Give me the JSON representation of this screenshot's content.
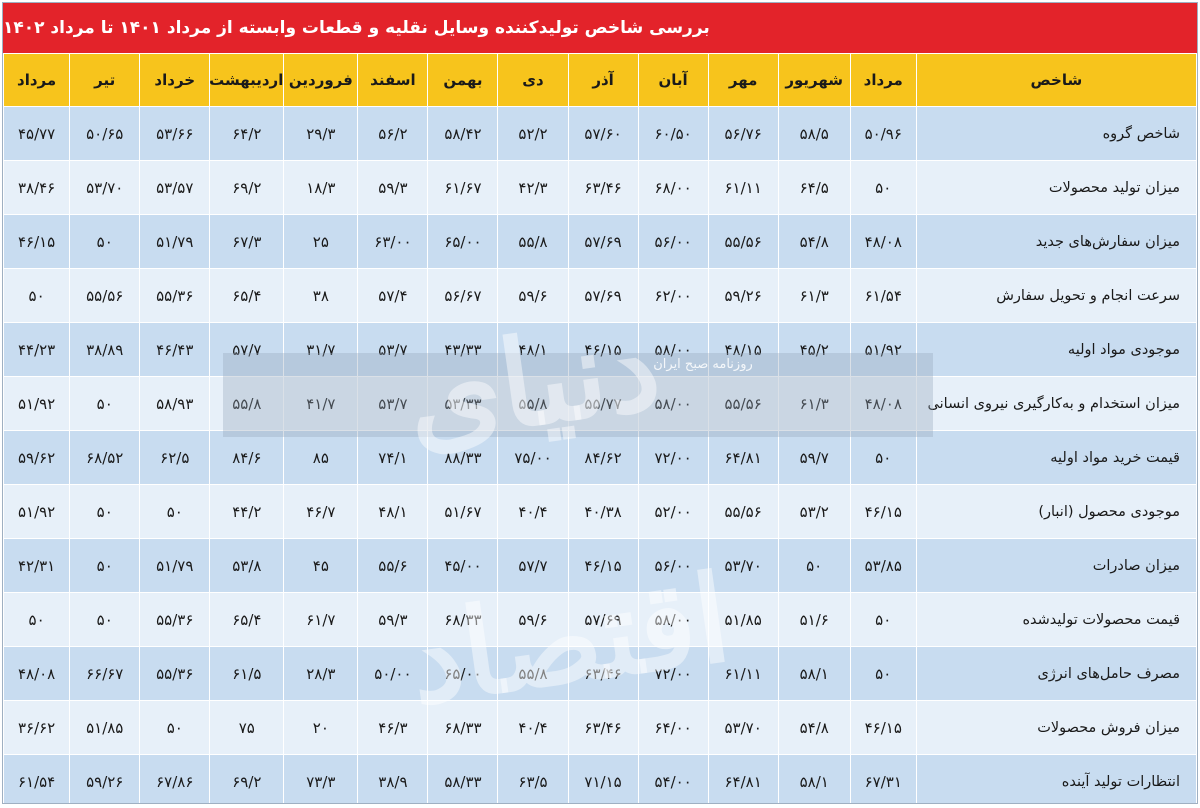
{
  "title": "بررسی شاخص تولیدکننده وسایل نقلیه و قطعات وابسته از مرداد ۱۴۰۱ تا مرداد ۱۴۰۲",
  "watermark": {
    "main": "دنیای اقتصاد",
    "sub": "روزنامه صبح ایران"
  },
  "chart_data": {
    "type": "table",
    "title": "بررسی شاخص تولیدکننده وسایل نقلیه و قطعات وابسته از مرداد ۱۴۰۱ تا مرداد ۱۴۰۲",
    "columns": [
      "شاخص",
      "مرداد",
      "شهریور",
      "مهر",
      "آبان",
      "آذر",
      "دی",
      "بهمن",
      "اسفند",
      "فروردین",
      "اردیبهشت",
      "خرداد",
      "تیر",
      "مرداد"
    ],
    "rows": [
      {
        "name": "شاخص گروه",
        "values": [
          "۵۰/۹۶",
          "۵۸/۵",
          "۵۶/۷۶",
          "۶۰/۵۰",
          "۵۷/۶۰",
          "۵۲/۲",
          "۵۸/۴۲",
          "۵۶/۲",
          "۲۹/۳",
          "۶۴/۲",
          "۵۳/۶۶",
          "۵۰/۶۵",
          "۴۵/۷۷"
        ]
      },
      {
        "name": "میزان تولید محصولات",
        "values": [
          "۵۰",
          "۶۴/۵",
          "۶۱/۱۱",
          "۶۸/۰۰",
          "۶۳/۴۶",
          "۴۲/۳",
          "۶۱/۶۷",
          "۵۹/۳",
          "۱۸/۳",
          "۶۹/۲",
          "۵۳/۵۷",
          "۵۳/۷۰",
          "۳۸/۴۶"
        ]
      },
      {
        "name": "میزان سفارش‌های جدید",
        "values": [
          "۴۸/۰۸",
          "۵۴/۸",
          "۵۵/۵۶",
          "۵۶/۰۰",
          "۵۷/۶۹",
          "۵۵/۸",
          "۶۵/۰۰",
          "۶۳/۰۰",
          "۲۵",
          "۶۷/۳",
          "۵۱/۷۹",
          "۵۰",
          "۴۶/۱۵"
        ]
      },
      {
        "name": "سرعت انجام و تحویل سفارش",
        "values": [
          "۶۱/۵۴",
          "۶۱/۳",
          "۵۹/۲۶",
          "۶۲/۰۰",
          "۵۷/۶۹",
          "۵۹/۶",
          "۵۶/۶۷",
          "۵۷/۴",
          "۳۸",
          "۶۵/۴",
          "۵۵/۳۶",
          "۵۵/۵۶",
          "۵۰"
        ]
      },
      {
        "name": "موجودی مواد اولیه",
        "values": [
          "۵۱/۹۲",
          "۴۵/۲",
          "۴۸/۱۵",
          "۵۸/۰۰",
          "۴۶/۱۵",
          "۴۸/۱",
          "۴۳/۳۳",
          "۵۳/۷",
          "۳۱/۷",
          "۵۷/۷",
          "۴۶/۴۳",
          "۳۸/۸۹",
          "۴۴/۲۳"
        ]
      },
      {
        "name": "میزان استخدام و به‌کارگیری نیروی انسانی",
        "values": [
          "۴۸/۰۸",
          "۶۱/۳",
          "۵۵/۵۶",
          "۵۸/۰۰",
          "۵۵/۷۷",
          "۵۵/۸",
          "۵۳/۳۳",
          "۵۳/۷",
          "۴۱/۷",
          "۵۵/۸",
          "۵۸/۹۳",
          "۵۰",
          "۵۱/۹۲"
        ]
      },
      {
        "name": "قیمت خرید مواد اولیه",
        "values": [
          "۵۰",
          "۵۹/۷",
          "۶۴/۸۱",
          "۷۲/۰۰",
          "۸۴/۶۲",
          "۷۵/۰۰",
          "۸۸/۳۳",
          "۷۴/۱",
          "۸۵",
          "۸۴/۶",
          "۶۲/۵",
          "۶۸/۵۲",
          "۵۹/۶۲"
        ]
      },
      {
        "name": "موجودی محصول (انبار)",
        "values": [
          "۴۶/۱۵",
          "۵۳/۲",
          "۵۵/۵۶",
          "۵۲/۰۰",
          "۴۰/۳۸",
          "۴۰/۴",
          "۵۱/۶۷",
          "۴۸/۱",
          "۴۶/۷",
          "۴۴/۲",
          "۵۰",
          "۵۰",
          "۵۱/۹۲"
        ]
      },
      {
        "name": "میزان صادرات",
        "values": [
          "۵۳/۸۵",
          "۵۰",
          "۵۳/۷۰",
          "۵۶/۰۰",
          "۴۶/۱۵",
          "۵۷/۷",
          "۴۵/۰۰",
          "۵۵/۶",
          "۴۵",
          "۵۳/۸",
          "۵۱/۷۹",
          "۵۰",
          "۴۲/۳۱"
        ]
      },
      {
        "name": "قیمت محصولات تولیدشده",
        "values": [
          "۵۰",
          "۵۱/۶",
          "۵۱/۸۵",
          "۵۸/۰۰",
          "۵۷/۶۹",
          "۵۹/۶",
          "۶۸/۳۳",
          "۵۹/۳",
          "۶۱/۷",
          "۶۵/۴",
          "۵۵/۳۶",
          "۵۰",
          "۵۰"
        ]
      },
      {
        "name": "مصرف حامل‌های انرژی",
        "values": [
          "۵۰",
          "۵۸/۱",
          "۶۱/۱۱",
          "۷۲/۰۰",
          "۶۳/۴۶",
          "۵۵/۸",
          "۶۵/۰۰",
          "۵۰/۰۰",
          "۲۸/۳",
          "۶۱/۵",
          "۵۵/۳۶",
          "۶۶/۶۷",
          "۴۸/۰۸"
        ]
      },
      {
        "name": "میزان فروش محصولات",
        "values": [
          "۴۶/۱۵",
          "۵۴/۸",
          "۵۳/۷۰",
          "۶۴/۰۰",
          "۶۳/۴۶",
          "۴۰/۴",
          "۶۸/۳۳",
          "۴۶/۳",
          "۲۰",
          "۷۵",
          "۵۰",
          "۵۱/۸۵",
          "۳۶/۶۲"
        ]
      },
      {
        "name": "انتظارات تولید آینده",
        "values": [
          "۶۷/۳۱",
          "۵۸/۱",
          "۶۴/۸۱",
          "۵۴/۰۰",
          "۷۱/۱۵",
          "۶۳/۵",
          "۵۸/۳۳",
          "۳۸/۹",
          "۷۳/۳",
          "۶۹/۲",
          "۶۷/۸۶",
          "۵۹/۲۶",
          "۶۱/۵۴"
        ]
      }
    ]
  }
}
